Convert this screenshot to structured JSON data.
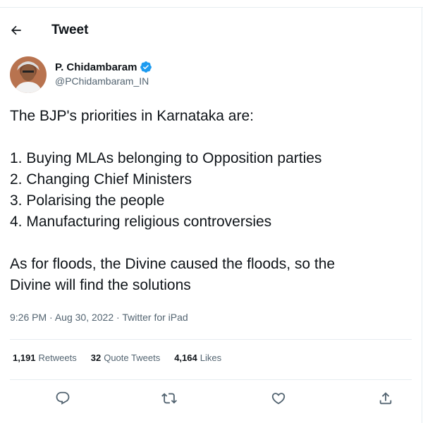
{
  "header": {
    "title": "Tweet",
    "back_icon": "arrow-left-icon"
  },
  "author": {
    "display_name": "P. Chidambaram",
    "handle": "@PChidambaram_IN",
    "verified_icon": "verified-badge-icon",
    "verified_color": "#1d9bf0"
  },
  "tweet": {
    "intro": "The BJP's priorities in Karnataka are:",
    "items": [
      "1. Buying MLAs belonging to Opposition parties",
      "2. Changing Chief Ministers",
      "3. Polarising the people",
      "4. Manufacturing religious controversies"
    ],
    "closing_line_1": "As for floods, the Divine caused the floods, so the",
    "closing_line_2": "Divine will find the solutions"
  },
  "meta": {
    "time": "9:26 PM",
    "separator": "·",
    "date": "Aug 30, 2022",
    "source": "Twitter for iPad"
  },
  "stats": {
    "retweets_count": "1,191",
    "retweets_label": "Retweets",
    "quote_count": "32",
    "quote_label": "Quote Tweets",
    "likes_count": "4,164",
    "likes_label": "Likes"
  },
  "actions": {
    "reply_icon": "reply-icon",
    "retweet_icon": "retweet-icon",
    "like_icon": "heart-icon",
    "share_icon": "share-icon"
  },
  "colors": {
    "text": "#0f1419",
    "secondary": "#536471",
    "divider": "#e6ecf0"
  }
}
